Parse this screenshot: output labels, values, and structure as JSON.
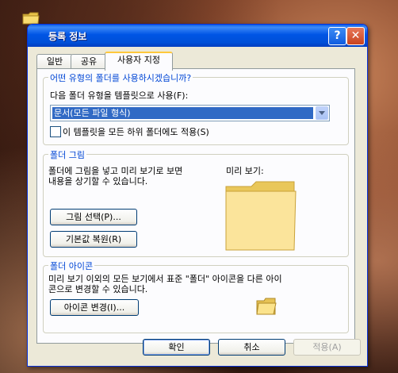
{
  "dialog": {
    "title": "등록 정보",
    "help_glyph": "?",
    "close_glyph": "✕"
  },
  "tabs": [
    {
      "label": "일반"
    },
    {
      "label": "공유"
    },
    {
      "label": "사용자 지정",
      "active": true
    }
  ],
  "template_group": {
    "legend": "어떤 유형의 폴더를 사용하시겠습니까?",
    "prompt": "다음 폴더 유형을 템플릿으로 사용(F):",
    "selected": "문서(모든 파일 형식)",
    "checkbox_label": "이 템플릿을 모든 하위 폴더에도 적용(S)",
    "checkbox_checked": false
  },
  "picture_group": {
    "legend": "폴더 그림",
    "desc_line1": "폴더에 그림을 넣고 미리 보기로 보면",
    "desc_line2": "내용을 상기할 수 있습니다.",
    "preview_label": "미리 보기:",
    "choose_button": "그림 선택(P)...",
    "restore_button": "기본값 복원(R)"
  },
  "icon_group": {
    "legend": "폴더 아이콘",
    "desc_line1": "미리 보기 이외의 모든 보기에서 표준 \"폴더\" 아이콘을 다른 아이",
    "desc_line2": "콘으로 변경할 수 있습니다.",
    "change_button": "아이콘 변경(I)..."
  },
  "footer": {
    "ok": "확인",
    "cancel": "취소",
    "apply": "적용(A)"
  },
  "colors": {
    "titlebar": "#0055e5",
    "group_legend": "#0046d5",
    "selection": "#316ac5",
    "tab_highlight": "#ffc83c"
  }
}
